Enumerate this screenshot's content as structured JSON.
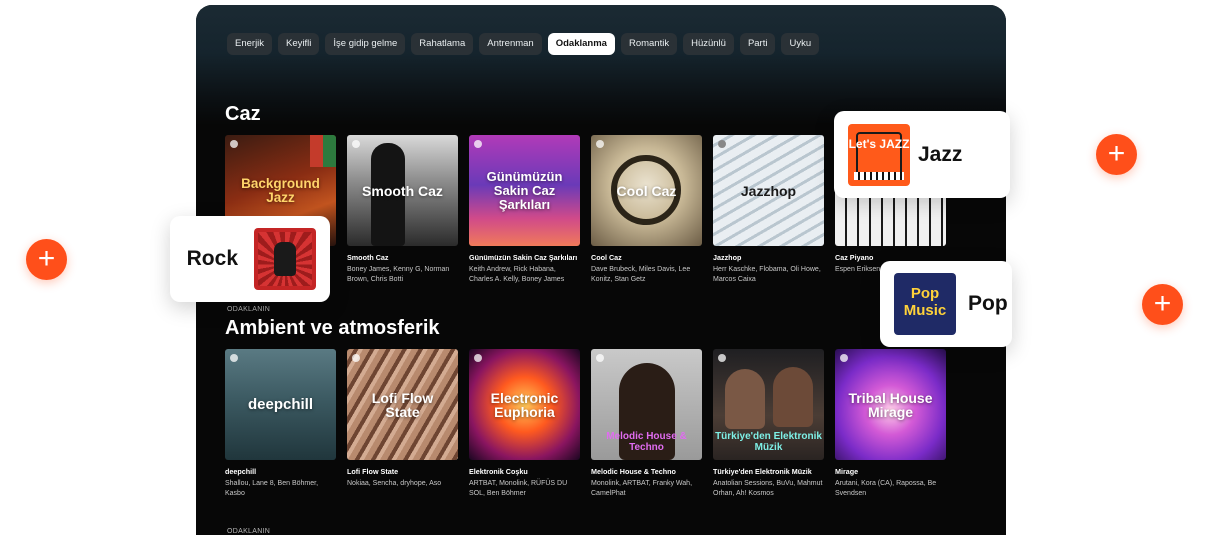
{
  "chips": [
    "Enerjik",
    "Keyifli",
    "İşe gidip gelme",
    "Rahatlama",
    "Antrenman",
    "Odaklanma",
    "Romantik",
    "Hüzünlü",
    "Parti",
    "Uyku"
  ],
  "active_chip": "Odaklanma",
  "sections": [
    {
      "title": "Caz",
      "eyebrow": "",
      "cards": [
        {
          "cover_text": "Background Jazz",
          "name": "",
          "artists": ""
        },
        {
          "cover_text": "Smooth Caz",
          "name": "Smooth Caz",
          "artists": "Boney James, Kenny G, Norman Brown, Chris Botti"
        },
        {
          "cover_text": "Günümüzün Sakin Caz Şarkıları",
          "name": "Günümüzün Sakin Caz Şarkıları",
          "artists": "Keith Andrew, Rick Habana, Charles A. Kelly, Boney James"
        },
        {
          "cover_text": "Cool Caz",
          "name": "Cool Caz",
          "artists": "Dave Brubeck, Miles Davis, Lee Konitz, Stan Getz"
        },
        {
          "cover_text": "Jazzhop",
          "name": "Jazzhop",
          "artists": "Herr Kaschke, Flobama, Oli Howe, Marcos Caixa"
        },
        {
          "cover_text": "",
          "name": "Caz Piyano",
          "artists": "Espen Eriksen Landström, K"
        }
      ]
    },
    {
      "title": "Ambient ve atmosferik",
      "eyebrow": "ODAKLANIN",
      "cards": [
        {
          "cover_text": "deepchill",
          "name": "deepchill",
          "artists": "Shallou, Lane 8, Ben Böhmer, Kasbo"
        },
        {
          "cover_text": "Lofi Flow State",
          "name": "Lofi Flow State",
          "artists": "Nokiaa, Sencha, dryhope, Aso"
        },
        {
          "cover_text": "Electronic Euphoria",
          "name": "Elektronik Coşku",
          "artists": "ARTBAT, Monolink, RÜFÜS DU SOL, Ben Böhmer"
        },
        {
          "cover_text": "Melodic House & Techno",
          "name": "Melodic House & Techno",
          "artists": "Monolink, ARTBAT, Franky Wah, CamelPhat"
        },
        {
          "cover_text": "Türkiye'den Elektronik Müzik",
          "name": "Türkiye'den Elektronik Müzik",
          "artists": "Anatolian Sessions, BuVu, Mahmut Orhan, Ah! Kosmos"
        },
        {
          "cover_text": "Tribal House Mirage",
          "name": "Mirage",
          "artists": "Arutani, Kora (CA), Rapossa, Be Svendsen"
        }
      ]
    }
  ],
  "bottom_eyebrow": "ODAKLANIN",
  "floating": {
    "jazz": {
      "label": "Jazz",
      "art_text": "Let's JAZZ"
    },
    "rock": {
      "label": "Rock"
    },
    "pop": {
      "label": "Pop",
      "art_text": "Pop Music"
    }
  },
  "colors": {
    "accent": "#ff4f1a",
    "app_bg": "#070707",
    "chip_bg": "#2a3136"
  }
}
